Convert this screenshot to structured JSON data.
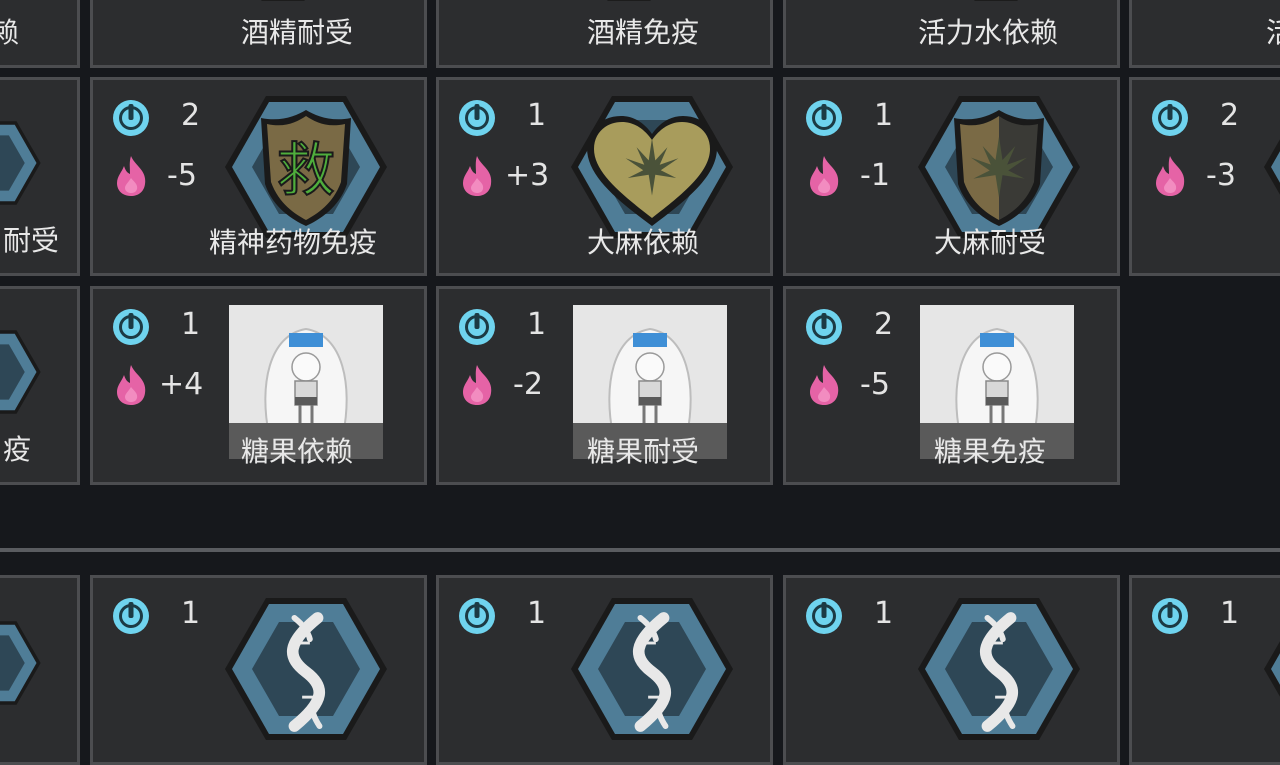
{
  "rows": {
    "top": [
      {
        "name": "赖",
        "id": "t0"
      },
      {
        "name": "酒精耐受",
        "id": "t1"
      },
      {
        "name": "酒精免疫",
        "id": "t2"
      },
      {
        "name": "活力水依赖",
        "id": "t3"
      },
      {
        "name": "活",
        "id": "t4"
      }
    ],
    "middle": [
      {
        "name": "耐受",
        "id": "m0"
      },
      {
        "name": "精神药物免疫",
        "complexity": "2",
        "power": "-5",
        "icon": "shield-drug-icon"
      },
      {
        "name": "大麻依赖",
        "complexity": "1",
        "power": "+3",
        "icon": "heart-leaf-icon"
      },
      {
        "name": "大麻耐受",
        "complexity": "1",
        "power": "-1",
        "icon": "shield-leaf-icon"
      },
      {
        "complexity": "2",
        "power": "-3"
      }
    ],
    "lower": [
      {
        "name": "疫",
        "id": "l0"
      },
      {
        "name": "糖果依赖",
        "complexity": "1",
        "power": "+4",
        "icon": "rain-girl-image"
      },
      {
        "name": "糖果耐受",
        "complexity": "1",
        "power": "-2",
        "icon": "rain-girl-image"
      },
      {
        "name": "糖果免疫",
        "complexity": "2",
        "power": "-5",
        "icon": "rain-girl-image"
      }
    ],
    "bottom": [
      {
        "complexity": "1",
        "icon": "dna-icon"
      },
      {
        "complexity": "1",
        "icon": "dna-icon"
      },
      {
        "complexity": "1",
        "icon": "dna-icon"
      },
      {
        "complexity": "1"
      }
    ]
  },
  "colors": {
    "card_bg": "#2c2d2f",
    "card_border": "#4c4d50",
    "complexity": "#6fd3ee",
    "power": "#e563a6",
    "hex_fill": "#4f7d97",
    "hex_inner": "#2e4756"
  }
}
